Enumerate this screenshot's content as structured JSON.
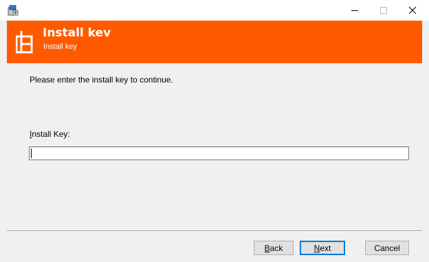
{
  "window": {
    "minimize_icon": "minimize-icon",
    "maximize_icon": "maximize-icon",
    "close_icon": "close-icon"
  },
  "header": {
    "title": "Install kev",
    "subtitle": "Install key",
    "background_color": "#ff5a00"
  },
  "body": {
    "instruction": "Please enter the install key to continue.",
    "field_label_accel": "I",
    "field_label_rest": "nstall Key:",
    "key_value": ""
  },
  "buttons": {
    "back_accel": "B",
    "back_rest": "ack",
    "next_accel": "N",
    "next_rest": "ext",
    "cancel": "Cancel"
  }
}
